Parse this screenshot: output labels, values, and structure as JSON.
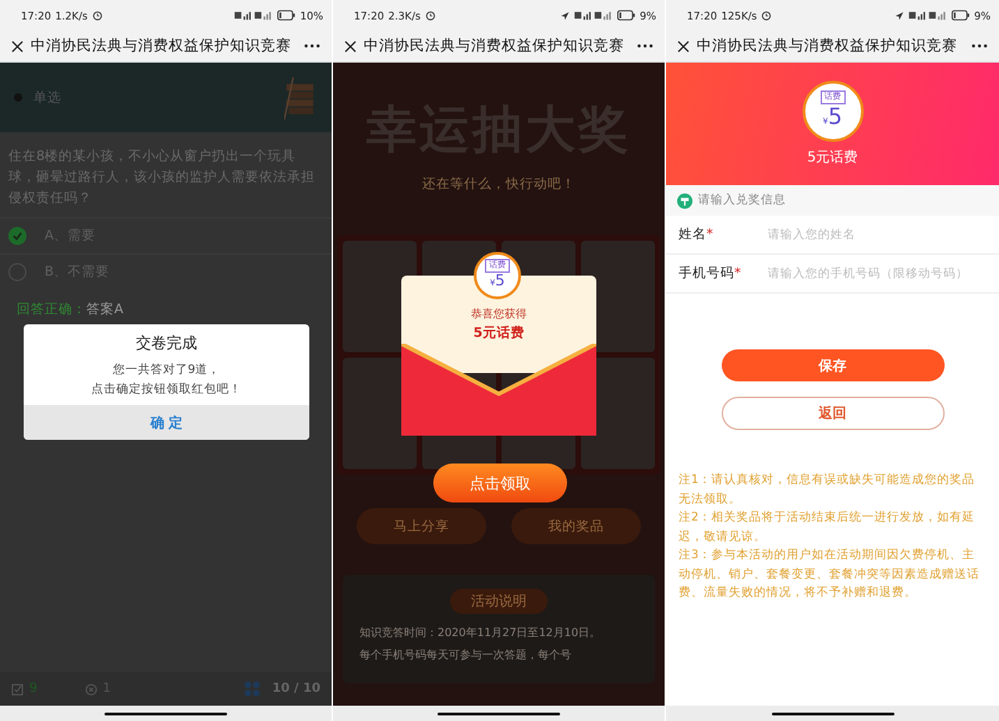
{
  "quiz_screen": {
    "status_bar": {
      "time": "17:20",
      "speed": "1.2K/s",
      "battery": "10%",
      "location": false
    },
    "title": "中消协民法典与消费权益保护知识竞赛",
    "question_type": "单选",
    "question": "住在8楼的某小孩，不小心从窗户扔出一个玩具球，砸晕过路行人，该小孩的监护人需要依法承担侵权责任吗？",
    "options": [
      {
        "label": "A、需要",
        "selected": true
      },
      {
        "label": "B、不需要",
        "selected": false
      }
    ],
    "result_label": "回答正确：",
    "result_answer": "答案A",
    "dialog": {
      "title": "交卷完成",
      "message": [
        "您一共答对了9道，",
        "点击确定按钮领取红包吧！"
      ],
      "button": "确 定"
    },
    "footer": {
      "correct": "9",
      "wrong": "1",
      "progress": "10 / 10"
    }
  },
  "lottery_screen": {
    "status_bar": {
      "time": "17:20",
      "speed": "2.3K/s",
      "battery": "9%",
      "location": true
    },
    "title": "中消协民法典与消费权益保护知识竞赛",
    "heading": "幸运抽大奖",
    "subheading": "还在等什么，快行动吧！",
    "actions": [
      "马上分享",
      "我的奖品"
    ],
    "rules_title": "活动说明",
    "rules": [
      "知识竞答时间：2020年11月27日至12月10日。",
      "每个手机号码每天可参与一次答题，每个号"
    ],
    "popup": {
      "badge": "话费",
      "currency": "¥",
      "amount": "5",
      "message": "恭喜您获得",
      "prize": "5元话费",
      "button": "点击领取"
    }
  },
  "prize_form_screen": {
    "status_bar": {
      "time": "17:20",
      "speed": "125K/s",
      "battery": "9%",
      "location": true
    },
    "title": "中消协民法典与消费权益保护知识竞赛",
    "badge": "话费",
    "currency": "¥",
    "amount": "5",
    "prize": "5元话费",
    "section": "请输入兑奖信息",
    "fields": [
      {
        "label": "姓名",
        "required_mark": "*",
        "placeholder": "请输入您的姓名"
      },
      {
        "label": "手机号码",
        "required_mark": "*",
        "placeholder": "请输入您的手机号码（限移动号码）"
      }
    ],
    "save_button": "保存",
    "back_button": "返回",
    "notes": [
      "注1：请认真核对，信息有误或缺失可能造成您的奖品无法领取。",
      "注2：相关奖品将于活动结束后统一进行发放，如有延迟，敬请见谅。",
      "注3：参与本活动的用户如在活动期间因欠费停机、主动停机、销户、套餐变更、套餐冲突等因素造成赠送话费、流量失败的情况，将不予补赠和退费。"
    ]
  }
}
